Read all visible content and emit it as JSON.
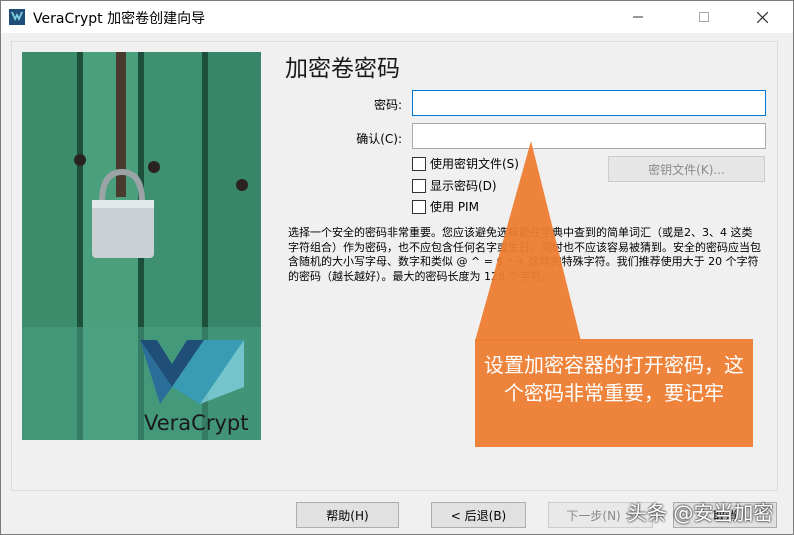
{
  "window": {
    "title": "VeraCrypt 加密卷创建向导",
    "minimize_icon": "minimize-icon",
    "maximize_icon": "maximize-icon",
    "close_icon": "close-icon"
  },
  "page": {
    "heading": "加密卷密码",
    "password_label": "密码:",
    "confirm_label": "确认(C):",
    "password_value": "",
    "confirm_value": "",
    "use_keyfiles_label": "使用密钥文件(S)",
    "show_password_label": "显示密码(D)",
    "use_pim_label": "使用 PIM",
    "keyfiles_button": "密钥文件(K)...",
    "info": "选择一个安全的密码非常重要。您应该避免选择能在字典中查到的简单词汇（或是2、3、4 这类字符组合）作为密码，也不应包含任何名字或生日，同时也不应该容易被猜到。安全的密码应当包含随机的大小写字母、数字和类似 @ ^ = $ * + 这样的特殊字符。我们推荐使用大于 20 个字符的密码（越长越好）。最大的密码长度为 128 个字符。"
  },
  "side_image": {
    "logo_text": "VeraCrypt"
  },
  "buttons": {
    "help": "帮助(H)",
    "back": "< 后退(B)",
    "next": "下一步(N) >",
    "cancel": "取消"
  },
  "callout": {
    "text": "设置加密容器的打开密码，这个密码非常重要，要记牢",
    "color": "#ed7d31"
  },
  "watermark": {
    "text": "头条 @安当加密"
  }
}
